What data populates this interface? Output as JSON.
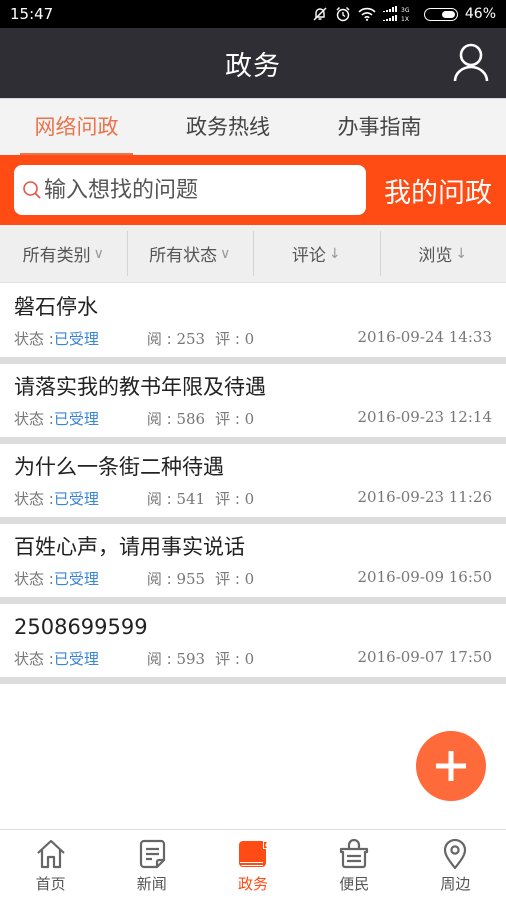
{
  "status_bar": {
    "time": "15:47",
    "icons": [
      "notifications-off-icon",
      "alarm-icon",
      "wifi-icon",
      "signal-3g-1x-icon",
      "battery-icon"
    ],
    "network_labels": [
      "3G",
      "1X"
    ],
    "battery": "46%"
  },
  "app_bar": {
    "title": "政务",
    "right_icon": "user-icon"
  },
  "tabs": [
    {
      "label": "网络问政",
      "active": true
    },
    {
      "label": "政务热线",
      "active": false
    },
    {
      "label": "办事指南",
      "active": false
    }
  ],
  "search": {
    "placeholder": "输入想找的问题",
    "value": "",
    "my_button_label": "我的问政"
  },
  "filters": [
    {
      "label": "所有类别",
      "indicator": "∨"
    },
    {
      "label": "所有状态",
      "indicator": "∨"
    },
    {
      "label": "评论",
      "indicator": "↓"
    },
    {
      "label": "浏览",
      "indicator": "↓"
    }
  ],
  "list": {
    "state_label": "状态 : ",
    "views_label": "阅 : ",
    "comments_label": "评 : ",
    "items": [
      {
        "title": "磐石停水",
        "state": "已受理",
        "views": "253",
        "comments": "0",
        "date": "2016-09-24 14:33"
      },
      {
        "title": "请落实我的教书年限及待遇",
        "state": "已受理",
        "views": "586",
        "comments": "0",
        "date": "2016-09-23 12:14"
      },
      {
        "title": "为什么一条街二种待遇",
        "state": "已受理",
        "views": "541",
        "comments": "0",
        "date": "2016-09-23 11:26"
      },
      {
        "title": "百姓心声，请用事实说话",
        "state": "已受理",
        "views": "955",
        "comments": "0",
        "date": "2016-09-09 16:50"
      },
      {
        "title": "2508699599",
        "state": "已受理",
        "views": "593",
        "comments": "0",
        "date": "2016-09-07 17:50"
      }
    ]
  },
  "fab": {
    "icon": "plus-icon"
  },
  "bottom_nav": [
    {
      "label": "首页",
      "icon": "home-icon",
      "active": false
    },
    {
      "label": "新闻",
      "icon": "news-icon",
      "active": false
    },
    {
      "label": "政务",
      "icon": "government-book-icon",
      "active": true
    },
    {
      "label": "便民",
      "icon": "basket-icon",
      "active": false
    },
    {
      "label": "周边",
      "icon": "location-pin-icon",
      "active": false
    }
  ],
  "colors": {
    "accent": "#ff4b14",
    "tab_active": "#e8754d",
    "app_bar": "#2e2e34",
    "state_blue": "#3a86d8",
    "fab": "#ff6a3a"
  }
}
